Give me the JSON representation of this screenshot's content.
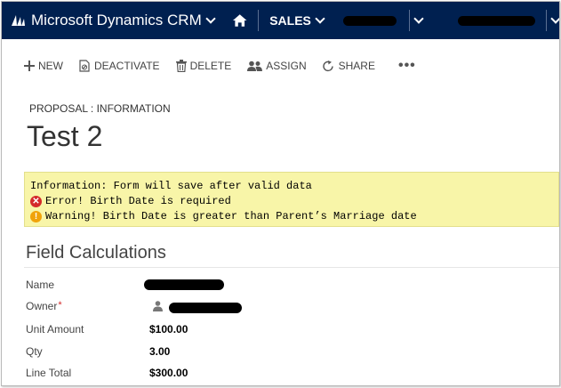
{
  "navbar": {
    "app_title": "Microsoft Dynamics CRM",
    "module": "SALES",
    "bg_color": "#002050"
  },
  "commands": {
    "new": "NEW",
    "deactivate": "DEACTIVATE",
    "delete": "DELETE",
    "assign": "ASSIGN",
    "share": "SHARE",
    "more": "•••"
  },
  "record": {
    "breadcrumb": "PROPOSAL : INFORMATION",
    "title": "Test 2"
  },
  "notifications": {
    "info": "Information: Form will save after valid data",
    "error": "Error! Birth Date is required",
    "warning": "Warning! Birth Date is greater than Parent’s Marriage date",
    "bg_color": "#f8f5a8"
  },
  "section": {
    "title": "Field Calculations",
    "fields": {
      "name_label": "Name",
      "owner_label": "Owner",
      "unit_amount_label": "Unit Amount",
      "unit_amount_value": "$100.00",
      "qty_label": "Qty",
      "qty_value": "3.00",
      "line_total_label": "Line Total",
      "line_total_value": "$300.00"
    }
  },
  "icons": {
    "logo": "dynamics-logo-icon",
    "home": "home-icon",
    "new": "plus-icon",
    "deactivate": "deactivate-icon",
    "delete": "trash-icon",
    "assign": "people-icon",
    "share": "share-icon",
    "error": "error-icon",
    "warning": "warning-icon",
    "owner": "user-icon"
  }
}
